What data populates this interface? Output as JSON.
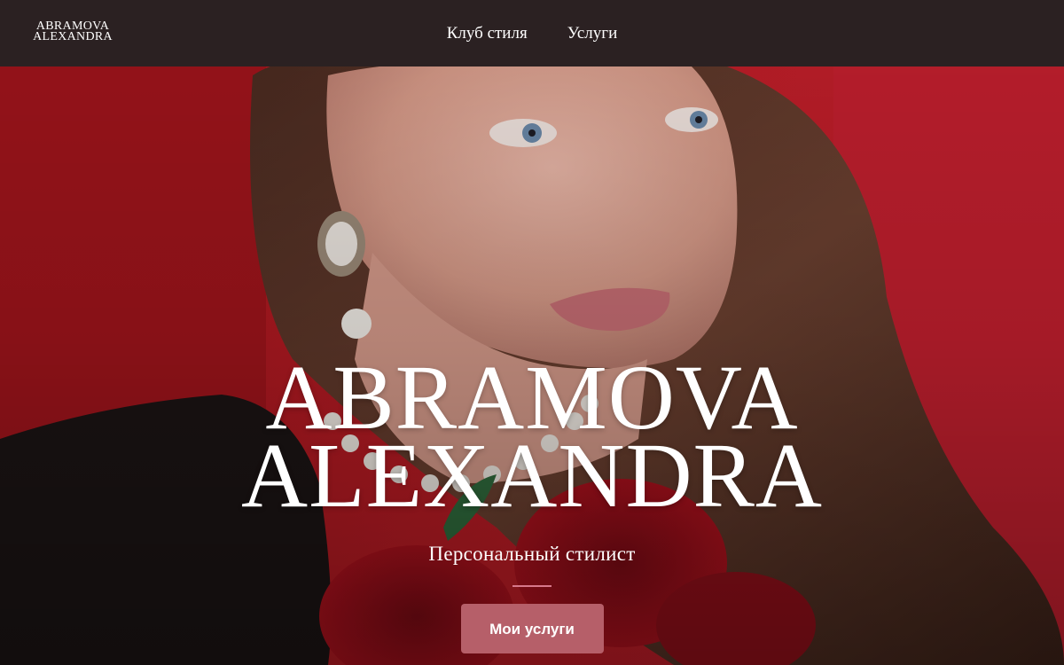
{
  "header": {
    "logo_line1": "ABRAMOVA",
    "logo_line2": "ALEXANDRA",
    "nav": [
      {
        "label": "Клуб стиля"
      },
      {
        "label": "Услуги"
      }
    ]
  },
  "hero": {
    "title_line1": "ABRAMOVA",
    "title_line2": "ALEXANDRA",
    "subtitle": "Персональный стилист",
    "cta_label": "Мои услуги",
    "image": "portrait-photo"
  },
  "colors": {
    "header_bg": "#2b2122",
    "hero_red": "#bc1c25",
    "divider": "#d7788b",
    "cta_bg": "#b65f69",
    "text": "#ffffff"
  }
}
